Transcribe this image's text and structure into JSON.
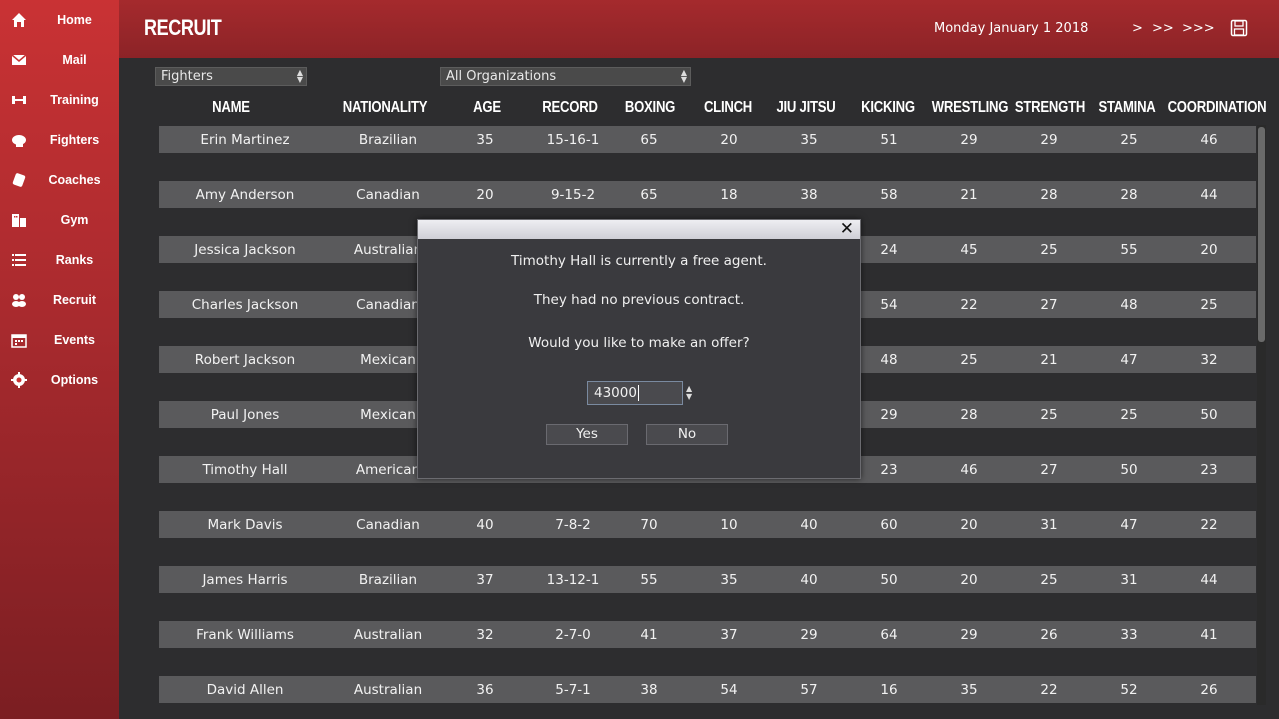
{
  "sidebar": {
    "items": [
      {
        "label": "Home",
        "icon": "home-icon"
      },
      {
        "label": "Mail",
        "icon": "mail-icon"
      },
      {
        "label": "Training",
        "icon": "dumbbell-icon"
      },
      {
        "label": "Fighters",
        "icon": "glove-icon"
      },
      {
        "label": "Coaches",
        "icon": "coach-icon"
      },
      {
        "label": "Gym",
        "icon": "building-icon"
      },
      {
        "label": "Ranks",
        "icon": "list-icon"
      },
      {
        "label": "Recruit",
        "icon": "group-icon"
      },
      {
        "label": "Events",
        "icon": "calendar-icon"
      },
      {
        "label": "Options",
        "icon": "gear-icon"
      }
    ]
  },
  "header": {
    "title": "RECRUIT",
    "date": "Monday January 1 2018",
    "advance": [
      ">",
      ">>",
      ">>>"
    ],
    "save_icon": "save-icon"
  },
  "filters": {
    "type": "Fighters",
    "organization": "All Organizations"
  },
  "table": {
    "columns": [
      "NAME",
      "NATIONALITY",
      "AGE",
      "RECORD",
      "BOXING",
      "CLINCH",
      "JIU JITSU",
      "KICKING",
      "WRESTLING",
      "STRENGTH",
      "STAMINA",
      "COORDINATION"
    ],
    "rows": [
      [
        "Erin Martinez",
        "Brazilian",
        "35",
        "15-16-1",
        "65",
        "20",
        "35",
        "51",
        "29",
        "29",
        "25",
        "46"
      ],
      [
        "Amy Anderson",
        "Canadian",
        "20",
        "9-15-2",
        "65",
        "18",
        "38",
        "58",
        "21",
        "28",
        "28",
        "44"
      ],
      [
        "Jessica Jackson",
        "Australian",
        "",
        "",
        "",
        "",
        "",
        "24",
        "45",
        "25",
        "55",
        "20"
      ],
      [
        "Charles Jackson",
        "Canadian",
        "",
        "",
        "",
        "",
        "",
        "54",
        "22",
        "27",
        "48",
        "25"
      ],
      [
        "Robert Jackson",
        "Mexican",
        "",
        "",
        "",
        "",
        "",
        "48",
        "25",
        "21",
        "47",
        "32"
      ],
      [
        "Paul Jones",
        "Mexican",
        "",
        "",
        "",
        "",
        "",
        "29",
        "28",
        "25",
        "25",
        "50"
      ],
      [
        "Timothy Hall",
        "American",
        "",
        "",
        "",
        "",
        "",
        "23",
        "46",
        "27",
        "50",
        "23"
      ],
      [
        "Mark Davis",
        "Canadian",
        "40",
        "7-8-2",
        "70",
        "10",
        "40",
        "60",
        "20",
        "31",
        "47",
        "22"
      ],
      [
        "James Harris",
        "Brazilian",
        "37",
        "13-12-1",
        "55",
        "35",
        "40",
        "50",
        "20",
        "25",
        "31",
        "44"
      ],
      [
        "Frank Williams",
        "Australian",
        "32",
        "2-7-0",
        "41",
        "37",
        "29",
        "64",
        "29",
        "26",
        "33",
        "41"
      ],
      [
        "David Allen",
        "Australian",
        "36",
        "5-7-1",
        "38",
        "54",
        "57",
        "16",
        "35",
        "22",
        "52",
        "26"
      ]
    ]
  },
  "dialog": {
    "line1": "Timothy Hall is currently a free agent.",
    "line2": "They had no previous contract.",
    "line3": "Would you like to make an offer?",
    "offer_value": "43000",
    "yes_label": "Yes",
    "no_label": "No",
    "close_glyph": "✕"
  },
  "colors": {
    "sidebar_top": "#c93234",
    "header": "#8c2327",
    "row_bg": "#5a5a5c",
    "background": "#2d2d2f"
  }
}
